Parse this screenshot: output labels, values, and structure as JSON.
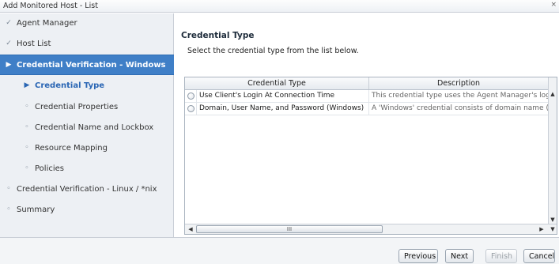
{
  "window": {
    "title": "Add Monitored Host - List",
    "close_glyph": "×"
  },
  "sidebar": {
    "items": [
      {
        "label": "Agent Manager",
        "icon": "✓",
        "level": 0,
        "state": "done"
      },
      {
        "label": "Host List",
        "icon": "✓",
        "level": 0,
        "state": "done"
      },
      {
        "label": "Credential Verification - Windows",
        "icon": "▶",
        "level": 0,
        "state": "selected"
      },
      {
        "label": "Credential Type",
        "icon": "▶",
        "level": 1,
        "state": "current"
      },
      {
        "label": "Credential Properties",
        "icon": "◦",
        "level": 1,
        "state": "pending"
      },
      {
        "label": "Credential Name and Lockbox",
        "icon": "◦",
        "level": 1,
        "state": "pending"
      },
      {
        "label": "Resource Mapping",
        "icon": "◦",
        "level": 1,
        "state": "pending"
      },
      {
        "label": "Policies",
        "icon": "◦",
        "level": 1,
        "state": "pending"
      },
      {
        "label": "Credential Verification - Linux / *nix",
        "icon": "◦",
        "level": 0,
        "state": "pending"
      },
      {
        "label": "Summary",
        "icon": "◦",
        "level": 0,
        "state": "pending"
      }
    ]
  },
  "main": {
    "heading": "Credential Type",
    "description": "Select the credential type from the list below.",
    "table": {
      "columns": [
        "Credential Type",
        "Description"
      ],
      "rows": [
        {
          "type": "Use Client's Login At Connection Time",
          "description": "This credential type uses the Agent Manager's login to"
        },
        {
          "type": "Domain, User Name, and Password (Windows)",
          "description": "A 'Windows' credential consists of domain name (if conf"
        }
      ],
      "hscroll_thumb_glyph": "III"
    }
  },
  "footer": {
    "buttons": {
      "previous": "Previous",
      "next": "Next",
      "finish": "Finish",
      "cancel": "Cancel"
    }
  }
}
